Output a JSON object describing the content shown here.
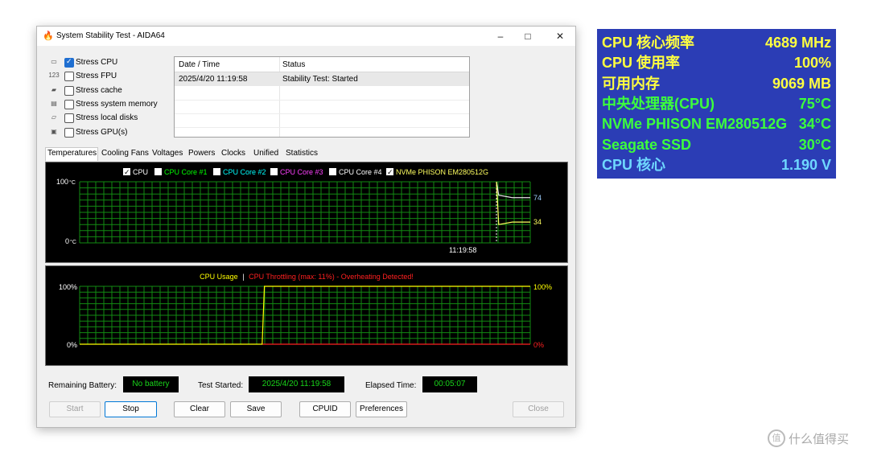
{
  "window": {
    "title": "System Stability Test - AIDA64",
    "app_icon": "flame-icon",
    "controls": {
      "minimize": "–",
      "maximize": "□",
      "close": "✕"
    }
  },
  "stress_options": [
    {
      "icon": "cpu-chip-icon",
      "label": "Stress CPU",
      "checked": true
    },
    {
      "icon": "fpu-123-icon",
      "label": "Stress FPU",
      "checked": false
    },
    {
      "icon": "cache-icon",
      "label": "Stress cache",
      "checked": false
    },
    {
      "icon": "memory-icon",
      "label": "Stress system memory",
      "checked": false
    },
    {
      "icon": "disk-icon",
      "label": "Stress local disks",
      "checked": false
    },
    {
      "icon": "gpu-icon",
      "label": "Stress GPU(s)",
      "checked": false
    }
  ],
  "log": {
    "columns": [
      "Date / Time",
      "Status"
    ],
    "rows": [
      [
        "2025/4/20 11:19:58",
        "Stability Test: Started"
      ]
    ]
  },
  "tabs": {
    "items": [
      "Temperatures",
      "Cooling Fans",
      "Voltages",
      "Powers",
      "Clocks",
      "Unified",
      "Statistics"
    ],
    "active": "Temperatures"
  },
  "temp_graph": {
    "legend": [
      {
        "label": "CPU",
        "checked": true,
        "color": "#ffffff"
      },
      {
        "label": "CPU Core #1",
        "checked": false,
        "color": "#00ff00"
      },
      {
        "label": "CPU Core #2",
        "checked": false,
        "color": "#00ffff"
      },
      {
        "label": "CPU Core #3",
        "checked": false,
        "color": "#ff40ff"
      },
      {
        "label": "CPU Core #4",
        "checked": false,
        "color": "#ffffff"
      },
      {
        "label": "NVMe PHISON EM280512G",
        "checked": true,
        "color": "#ffff60"
      }
    ],
    "y_max_label": "100",
    "y_min_label": "0",
    "unit": "°C",
    "time_label": "11:19:58",
    "series": [
      {
        "name": "CPU",
        "color": "#e6e6e6",
        "current_label": "74",
        "points": [
          [
            0.925,
            100
          ],
          [
            0.93,
            78
          ],
          [
            0.96,
            74
          ],
          [
            1.0,
            74
          ]
        ]
      },
      {
        "name": "NVMe PHISON EM280512G",
        "color": "#ffff60",
        "current_label": "34",
        "points": [
          [
            0.925,
            100
          ],
          [
            0.93,
            30
          ],
          [
            0.96,
            34
          ],
          [
            1.0,
            34
          ]
        ]
      }
    ]
  },
  "cpu_graph": {
    "title_usage": "CPU Usage",
    "separator": "|",
    "title_throttle": "CPU Throttling (max: 11%) - Overheating Detected!",
    "usage_color": "#ffff00",
    "throttle_color": "#ff2020",
    "y_max_label": "100%",
    "y_min_label": "0%",
    "usage_current": "100%",
    "throttle_current": "0%",
    "usage_points": [
      [
        0.0,
        0
      ],
      [
        0.405,
        0
      ],
      [
        0.41,
        100
      ],
      [
        1.0,
        100
      ]
    ],
    "throttle_points": [
      [
        0.405,
        0
      ],
      [
        1.0,
        0
      ]
    ]
  },
  "status": {
    "battery_label": "Remaining Battery:",
    "battery_value": "No battery",
    "started_label": "Test Started:",
    "started_value": "2025/4/20 11:19:58",
    "elapsed_label": "Elapsed Time:",
    "elapsed_value": "00:05:07"
  },
  "buttons": {
    "start": "Start",
    "stop": "Stop",
    "clear": "Clear",
    "save": "Save",
    "cpuid": "CPUID",
    "preferences": "Preferences",
    "close": "Close"
  },
  "sensor_panel": {
    "background": "#2b3db5",
    "rows": [
      {
        "name": "CPU 核心频率",
        "value": "4689 MHz",
        "color": "#ffff40"
      },
      {
        "name": "CPU 使用率",
        "value": "100%",
        "color": "#ffff40"
      },
      {
        "name": "可用内存",
        "value": "9069 MB",
        "color": "#ffff40"
      },
      {
        "name": "中央处理器(CPU)",
        "value": "75°C",
        "color": "#3cff3c"
      },
      {
        "name": "NVMe PHISON EM280512G",
        "value": "34°C",
        "color": "#3cff3c"
      },
      {
        "name": "Seagate SSD",
        "value": "30°C",
        "color": "#3cff3c"
      },
      {
        "name": "CPU 核心",
        "value": "1.190 V",
        "color": "#6fd8ff"
      }
    ]
  },
  "watermark": {
    "icon": "zhi-icon",
    "text": "什么值得买"
  }
}
